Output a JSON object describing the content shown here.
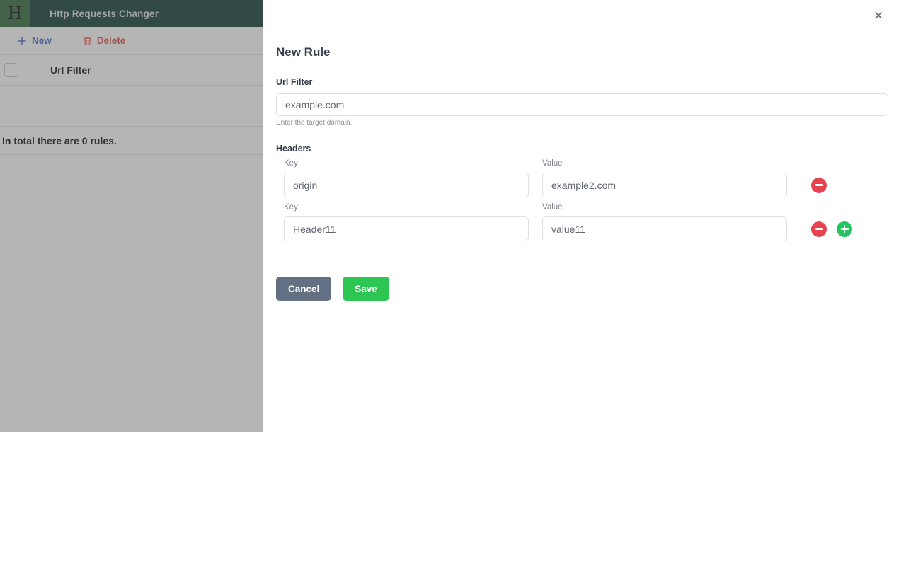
{
  "app": {
    "logo_letter": "H",
    "title": "Http Requests Changer",
    "header_bg": "#103c35",
    "logo_bg": "#2f6b38",
    "toolbar": {
      "new_label": "New",
      "new_icon": "plus-icon",
      "new_color": "#4164c9",
      "delete_label": "Delete",
      "delete_icon": "trash-icon",
      "delete_color": "#d9534f"
    },
    "table": {
      "select_all_checkbox": "",
      "columns": [
        "Url Filter"
      ],
      "rows": [],
      "footer_text": "In total there are 0 rules."
    }
  },
  "modal": {
    "close_icon": "close-icon",
    "close_glyph": "✕",
    "title": "New Rule",
    "url_filter": {
      "label": "Url Filter",
      "value": "example.com",
      "placeholder": "example.com",
      "help": "Enter the target domain."
    },
    "headers": {
      "label": "Headers",
      "key_label": "Key",
      "value_label": "Value",
      "rows": [
        {
          "key_label": "Key",
          "value_label": "Value",
          "key": "origin",
          "key_placeholder": "origin",
          "value": "example2.com",
          "value_placeholder": "example2.com",
          "remove_icon": "minus-circle-icon",
          "add_icon": null
        },
        {
          "key_label": "Key",
          "value_label": "Value",
          "key": "Header11",
          "key_placeholder": "Header11",
          "value": "value11",
          "value_placeholder": "value11",
          "remove_icon": "minus-circle-icon",
          "add_icon": "plus-circle-icon"
        }
      ],
      "remove_color": "#e8414f",
      "add_color": "#22c55e"
    },
    "actions": {
      "cancel_label": "Cancel",
      "cancel_color": "#637083",
      "save_label": "Save",
      "save_color": "#2dc653"
    }
  }
}
